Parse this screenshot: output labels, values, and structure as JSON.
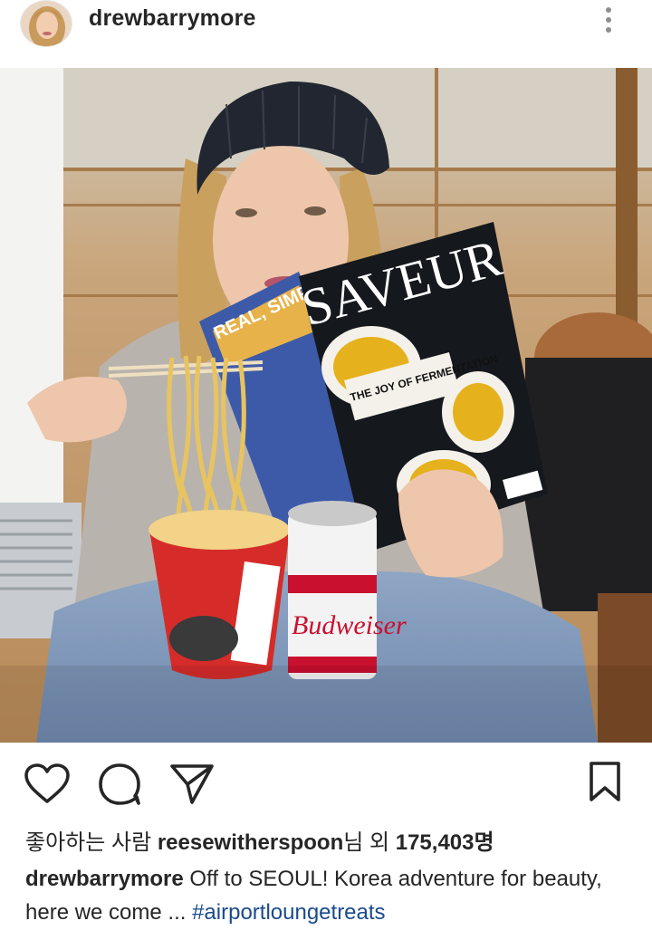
{
  "post": {
    "username": "drewbarrymore",
    "more_icon": "more-vertical-icon"
  },
  "photo_text": {
    "magazine_title": "SAVEUR",
    "magazine_headline": "THE JOY OF FERMENTATION",
    "other_magazine_title": "REAL, SIMPLE",
    "can_brand": "Budweiser"
  },
  "actions": {
    "like_icon": "heart-icon",
    "comment_icon": "comment-icon",
    "share_icon": "send-icon",
    "save_icon": "bookmark-icon"
  },
  "likes": {
    "prefix": "좋아하는 사람 ",
    "user": "reesewitherspoon",
    "middle": "님 외 ",
    "count": "175,403",
    "suffix": "명"
  },
  "caption": {
    "user": "drewbarrymore",
    "text": " Off to SEOUL! Korea adventure for beauty, here we come ... ",
    "hashtag": "#airportloungetreats"
  },
  "colors": {
    "text": "#262626",
    "hashtag": "#1a4b8c",
    "icon": "#262626"
  }
}
